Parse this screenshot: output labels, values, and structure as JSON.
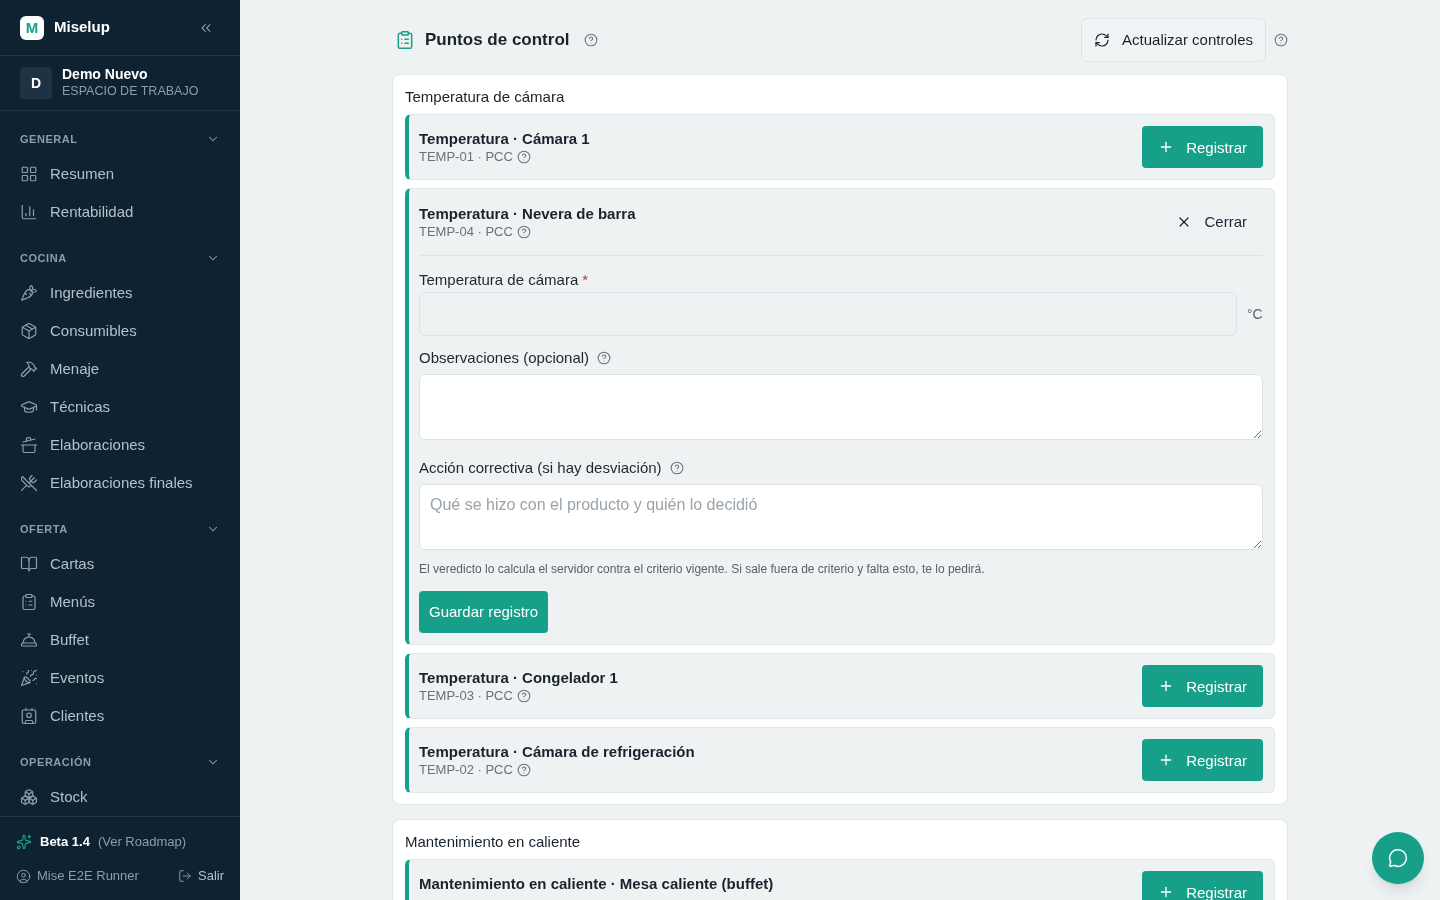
{
  "sidebar": {
    "brand": {
      "logo": "M",
      "name": "Miselup"
    },
    "workspace": {
      "initial": "D",
      "name": "Demo Nuevo",
      "label": "ESPACIO DE TRABAJO"
    },
    "sections": [
      {
        "title": "GENERAL",
        "expanded": true,
        "items": [
          {
            "label": "Resumen",
            "selected": false
          },
          {
            "label": "Rentabilidad",
            "selected": false
          }
        ]
      },
      {
        "title": "COCINA",
        "expanded": true,
        "items": [
          {
            "label": "Ingredientes",
            "selected": false
          },
          {
            "label": "Consumibles",
            "selected": false
          },
          {
            "label": "Menaje",
            "selected": false
          },
          {
            "label": "Técnicas",
            "selected": false
          },
          {
            "label": "Elaboraciones",
            "selected": false
          },
          {
            "label": "Elaboraciones finales",
            "selected": false
          }
        ]
      },
      {
        "title": "OFERTA",
        "expanded": true,
        "items": [
          {
            "label": "Cartas",
            "selected": false
          },
          {
            "label": "Menús",
            "selected": false
          },
          {
            "label": "Buffet",
            "selected": false
          },
          {
            "label": "Eventos",
            "selected": false
          },
          {
            "label": "Clientes",
            "selected": false
          }
        ]
      },
      {
        "title": "OPERACIÓN",
        "expanded": true,
        "items": [
          {
            "label": "Stock",
            "selected": false
          }
        ]
      }
    ],
    "footer": {
      "version": "Beta 1.4",
      "roadmap_link": "(Ver Roadmap)",
      "user": "Mise E2E Runner",
      "logout": "Salir"
    }
  },
  "header": {
    "title": "Puntos de control",
    "refresh_button": "Actualizar controles"
  },
  "groups": [
    {
      "title": "Temperatura de cámara",
      "controls": [
        {
          "name": "Temperatura · Cámara 1",
          "code": "TEMP-01 · PCC",
          "expanded": false,
          "action": "Registrar"
        },
        {
          "name": "Temperatura · Nevera de barra",
          "code": "TEMP-04 · PCC",
          "expanded": true,
          "action": "Cerrar",
          "form": {
            "fields": [
              {
                "kind": "number",
                "label": "Temperatura de cámara",
                "required_mark": "*",
                "help": false,
                "unit": "°C"
              },
              {
                "kind": "textarea",
                "label": "Observaciones (opcional)",
                "help": true
              },
              {
                "kind": "textarea",
                "label": "Acción correctiva (si hay desviación)",
                "help": true,
                "placeholder": "Qué se hizo con el producto y quién lo decidió"
              }
            ],
            "note": "El veredicto lo calcula el servidor contra el criterio vigente. Si sale fuera de criterio y falta esto, te lo pedirá.",
            "submit": "Guardar registro"
          }
        },
        {
          "name": "Temperatura · Congelador 1",
          "code": "TEMP-03 · PCC",
          "expanded": false,
          "action": "Registrar"
        },
        {
          "name": "Temperatura · Cámara de refrigeración",
          "code": "TEMP-02 · PCC",
          "expanded": false,
          "action": "Registrar"
        }
      ]
    },
    {
      "title": "Mantenimiento en caliente",
      "controls": [
        {
          "name": "Mantenimiento en caliente · Mesa caliente (buffet)",
          "expanded": false,
          "action": "Registrar"
        }
      ]
    }
  ]
}
